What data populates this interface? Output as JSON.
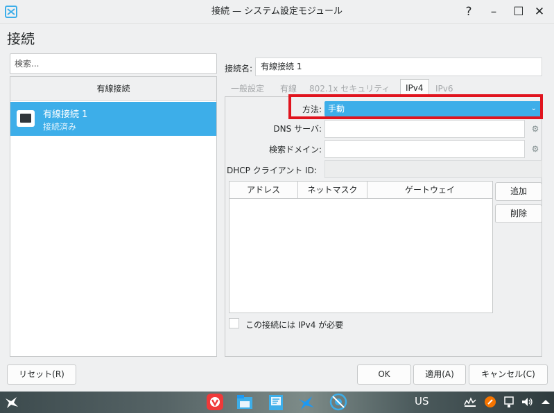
{
  "window": {
    "title": "接続 — システム設定モジュール",
    "help": "?",
    "minimize": "–",
    "maximize": "☐",
    "close": "✕"
  },
  "page": {
    "heading": "接続"
  },
  "left_panel": {
    "search_placeholder": "検索...",
    "list_header": "有線接続",
    "connections": [
      {
        "name": "有線接続 1",
        "status": "接続済み",
        "icon": "ethernet-icon"
      }
    ]
  },
  "right_panel": {
    "connection_name_label": "接続名:",
    "connection_name_value": "有線接続 1",
    "tabs": [
      "一般設定",
      "有線",
      "802.1x セキュリティ",
      "IPv4",
      "IPv6"
    ],
    "active_tab": "IPv4",
    "method_label": "方法:",
    "method_value": "手動",
    "dns_label": "DNS サーバ:",
    "search_domain_label": "検索ドメイン:",
    "dhcp_label": "DHCP クライアント ID:",
    "table_headers": [
      "アドレス",
      "ネットマスク",
      "ゲートウェイ"
    ],
    "add_button": "追加",
    "delete_button": "削除",
    "require_ipv4_label": "この接続には IPv4 が必要",
    "require_ipv4_checked": false
  },
  "buttons": {
    "reset": "リセット(R)",
    "ok": "OK",
    "apply": "適用(A)",
    "cancel": "キャンセル(C)"
  },
  "taskbar": {
    "keyboard_layout": "US",
    "icons": [
      "app-menu-icon",
      "vivaldi-icon",
      "file-manager-icon",
      "discover-icon",
      "kde-icon",
      "system-settings-icon"
    ],
    "tray": [
      "network-icon",
      "update-icon",
      "device-icon",
      "volume-icon",
      "tray-expand-icon"
    ]
  },
  "colors": {
    "selection": "#3daee9",
    "highlight_border": "#e0141e",
    "background": "#eff0f1"
  }
}
